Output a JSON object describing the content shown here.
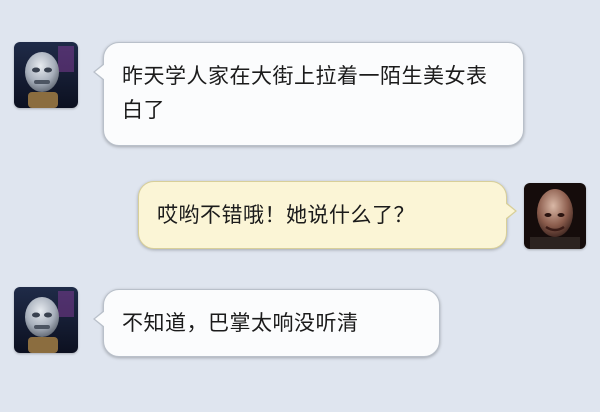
{
  "conversation": {
    "messages": [
      {
        "sender": "friend",
        "side": "left",
        "text": "昨天学人家在大街上拉着一陌生美女表白了"
      },
      {
        "sender": "me",
        "side": "right",
        "text": "哎哟不错哦！她说什么了？"
      },
      {
        "sender": "friend",
        "side": "left",
        "text": "不知道，巴掌太响没听清"
      }
    ],
    "avatars": {
      "friend": "robot-face-avatar",
      "me": "bald-alien-avatar"
    }
  },
  "colors": {
    "background": "#dfe5ef",
    "incoming_bubble": "#fbfcfd",
    "outgoing_bubble": "#fbf5d6"
  }
}
